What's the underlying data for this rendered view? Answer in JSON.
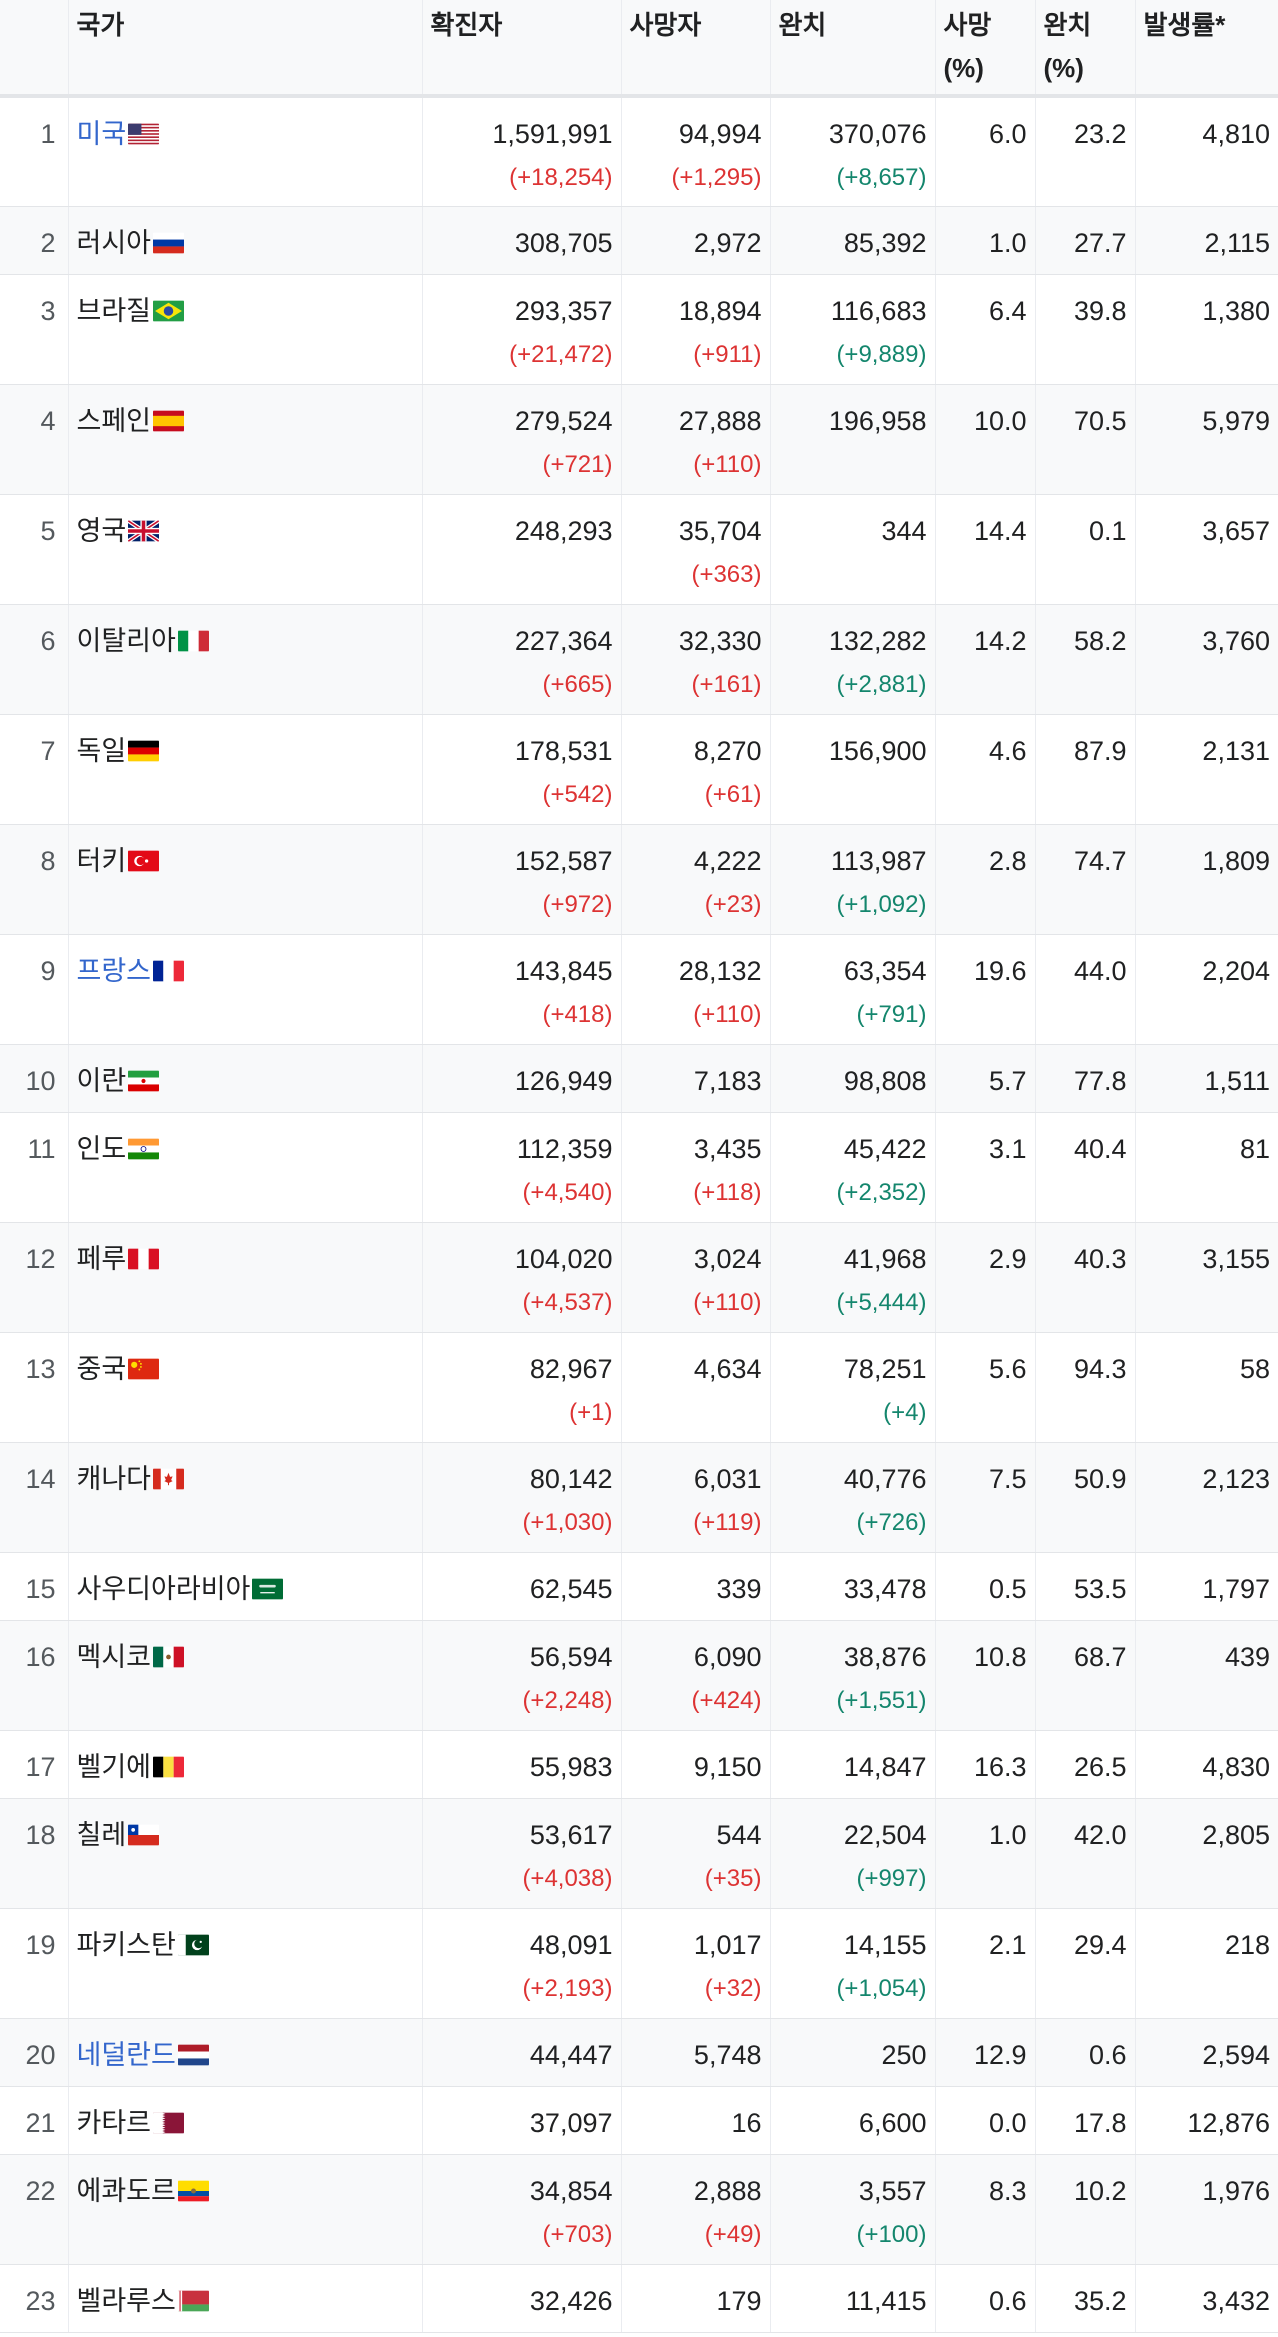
{
  "headers": {
    "rank": "",
    "country": "국가",
    "confirmed": "확진자",
    "deaths": "사망자",
    "recovered": "완치",
    "death_rate_line1": "사망",
    "death_rate_line2": "(%)",
    "recovery_rate_line1": "완치",
    "recovery_rate_line2": "(%)",
    "incidence": "발생률*"
  },
  "rows": [
    {
      "rank": "1",
      "country": "미국",
      "flag": "us-flag-icon",
      "link": true,
      "confirmed": "1,591,991",
      "confirmed_delta": "(+18,254)",
      "deaths": "94,994",
      "deaths_delta": "(+1,295)",
      "recovered": "370,076",
      "recovered_delta": "(+8,657)",
      "death_rate": "6.0",
      "recovery_rate": "23.2",
      "incidence": "4,810"
    },
    {
      "rank": "2",
      "country": "러시아",
      "flag": "russia-flag-icon",
      "link": false,
      "confirmed": "308,705",
      "confirmed_delta": "",
      "deaths": "2,972",
      "deaths_delta": "",
      "recovered": "85,392",
      "recovered_delta": "",
      "death_rate": "1.0",
      "recovery_rate": "27.7",
      "incidence": "2,115"
    },
    {
      "rank": "3",
      "country": "브라질",
      "flag": "brazil-flag-icon",
      "link": false,
      "confirmed": "293,357",
      "confirmed_delta": "(+21,472)",
      "deaths": "18,894",
      "deaths_delta": "(+911)",
      "recovered": "116,683",
      "recovered_delta": "(+9,889)",
      "death_rate": "6.4",
      "recovery_rate": "39.8",
      "incidence": "1,380"
    },
    {
      "rank": "4",
      "country": "스페인",
      "flag": "spain-flag-icon",
      "link": false,
      "confirmed": "279,524",
      "confirmed_delta": "(+721)",
      "deaths": "27,888",
      "deaths_delta": "(+110)",
      "recovered": "196,958",
      "recovered_delta": "",
      "death_rate": "10.0",
      "recovery_rate": "70.5",
      "incidence": "5,979"
    },
    {
      "rank": "5",
      "country": "영국",
      "flag": "uk-flag-icon",
      "link": false,
      "confirmed": "248,293",
      "confirmed_delta": "",
      "deaths": "35,704",
      "deaths_delta": "(+363)",
      "recovered": "344",
      "recovered_delta": "",
      "death_rate": "14.4",
      "recovery_rate": "0.1",
      "incidence": "3,657"
    },
    {
      "rank": "6",
      "country": "이탈리아",
      "flag": "italy-flag-icon",
      "link": false,
      "confirmed": "227,364",
      "confirmed_delta": "(+665)",
      "deaths": "32,330",
      "deaths_delta": "(+161)",
      "recovered": "132,282",
      "recovered_delta": "(+2,881)",
      "death_rate": "14.2",
      "recovery_rate": "58.2",
      "incidence": "3,760"
    },
    {
      "rank": "7",
      "country": "독일",
      "flag": "germany-flag-icon",
      "link": false,
      "confirmed": "178,531",
      "confirmed_delta": "(+542)",
      "deaths": "8,270",
      "deaths_delta": "(+61)",
      "recovered": "156,900",
      "recovered_delta": "",
      "death_rate": "4.6",
      "recovery_rate": "87.9",
      "incidence": "2,131"
    },
    {
      "rank": "8",
      "country": "터키",
      "flag": "turkey-flag-icon",
      "link": false,
      "confirmed": "152,587",
      "confirmed_delta": "(+972)",
      "deaths": "4,222",
      "deaths_delta": "(+23)",
      "recovered": "113,987",
      "recovered_delta": "(+1,092)",
      "death_rate": "2.8",
      "recovery_rate": "74.7",
      "incidence": "1,809"
    },
    {
      "rank": "9",
      "country": "프랑스",
      "flag": "france-flag-icon",
      "link": true,
      "confirmed": "143,845",
      "confirmed_delta": "(+418)",
      "deaths": "28,132",
      "deaths_delta": "(+110)",
      "recovered": "63,354",
      "recovered_delta": "(+791)",
      "death_rate": "19.6",
      "recovery_rate": "44.0",
      "incidence": "2,204"
    },
    {
      "rank": "10",
      "country": "이란",
      "flag": "iran-flag-icon",
      "link": false,
      "confirmed": "126,949",
      "confirmed_delta": "",
      "deaths": "7,183",
      "deaths_delta": "",
      "recovered": "98,808",
      "recovered_delta": "",
      "death_rate": "5.7",
      "recovery_rate": "77.8",
      "incidence": "1,511"
    },
    {
      "rank": "11",
      "country": "인도",
      "flag": "india-flag-icon",
      "link": false,
      "confirmed": "112,359",
      "confirmed_delta": "(+4,540)",
      "deaths": "3,435",
      "deaths_delta": "(+118)",
      "recovered": "45,422",
      "recovered_delta": "(+2,352)",
      "death_rate": "3.1",
      "recovery_rate": "40.4",
      "incidence": "81"
    },
    {
      "rank": "12",
      "country": "페루",
      "flag": "peru-flag-icon",
      "link": false,
      "confirmed": "104,020",
      "confirmed_delta": "(+4,537)",
      "deaths": "3,024",
      "deaths_delta": "(+110)",
      "recovered": "41,968",
      "recovered_delta": "(+5,444)",
      "death_rate": "2.9",
      "recovery_rate": "40.3",
      "incidence": "3,155"
    },
    {
      "rank": "13",
      "country": "중국",
      "flag": "china-flag-icon",
      "link": false,
      "confirmed": "82,967",
      "confirmed_delta": "(+1)",
      "deaths": "4,634",
      "deaths_delta": "",
      "recovered": "78,251",
      "recovered_delta": "(+4)",
      "death_rate": "5.6",
      "recovery_rate": "94.3",
      "incidence": "58"
    },
    {
      "rank": "14",
      "country": "캐나다",
      "flag": "canada-flag-icon",
      "link": false,
      "confirmed": "80,142",
      "confirmed_delta": "(+1,030)",
      "deaths": "6,031",
      "deaths_delta": "(+119)",
      "recovered": "40,776",
      "recovered_delta": "(+726)",
      "death_rate": "7.5",
      "recovery_rate": "50.9",
      "incidence": "2,123"
    },
    {
      "rank": "15",
      "country": "사우디아라비아",
      "flag": "saudi-arabia-flag-icon",
      "link": false,
      "confirmed": "62,545",
      "confirmed_delta": "",
      "deaths": "339",
      "deaths_delta": "",
      "recovered": "33,478",
      "recovered_delta": "",
      "death_rate": "0.5",
      "recovery_rate": "53.5",
      "incidence": "1,797"
    },
    {
      "rank": "16",
      "country": "멕시코",
      "flag": "mexico-flag-icon",
      "link": false,
      "confirmed": "56,594",
      "confirmed_delta": "(+2,248)",
      "deaths": "6,090",
      "deaths_delta": "(+424)",
      "recovered": "38,876",
      "recovered_delta": "(+1,551)",
      "death_rate": "10.8",
      "recovery_rate": "68.7",
      "incidence": "439"
    },
    {
      "rank": "17",
      "country": "벨기에",
      "flag": "belgium-flag-icon",
      "link": false,
      "confirmed": "55,983",
      "confirmed_delta": "",
      "deaths": "9,150",
      "deaths_delta": "",
      "recovered": "14,847",
      "recovered_delta": "",
      "death_rate": "16.3",
      "recovery_rate": "26.5",
      "incidence": "4,830"
    },
    {
      "rank": "18",
      "country": "칠레",
      "flag": "chile-flag-icon",
      "link": false,
      "confirmed": "53,617",
      "confirmed_delta": "(+4,038)",
      "deaths": "544",
      "deaths_delta": "(+35)",
      "recovered": "22,504",
      "recovered_delta": "(+997)",
      "death_rate": "1.0",
      "recovery_rate": "42.0",
      "incidence": "2,805"
    },
    {
      "rank": "19",
      "country": "파키스탄",
      "flag": "pakistan-flag-icon",
      "link": false,
      "confirmed": "48,091",
      "confirmed_delta": "(+2,193)",
      "deaths": "1,017",
      "deaths_delta": "(+32)",
      "recovered": "14,155",
      "recovered_delta": "(+1,054)",
      "death_rate": "2.1",
      "recovery_rate": "29.4",
      "incidence": "218"
    },
    {
      "rank": "20",
      "country": "네덜란드",
      "flag": "netherlands-flag-icon",
      "link": true,
      "confirmed": "44,447",
      "confirmed_delta": "",
      "deaths": "5,748",
      "deaths_delta": "",
      "recovered": "250",
      "recovered_delta": "",
      "death_rate": "12.9",
      "recovery_rate": "0.6",
      "incidence": "2,594"
    },
    {
      "rank": "21",
      "country": "카타르",
      "flag": "qatar-flag-icon",
      "link": false,
      "confirmed": "37,097",
      "confirmed_delta": "",
      "deaths": "16",
      "deaths_delta": "",
      "recovered": "6,600",
      "recovered_delta": "",
      "death_rate": "0.0",
      "recovery_rate": "17.8",
      "incidence": "12,876"
    },
    {
      "rank": "22",
      "country": "에콰도르",
      "flag": "ecuador-flag-icon",
      "link": false,
      "confirmed": "34,854",
      "confirmed_delta": "(+703)",
      "deaths": "2,888",
      "deaths_delta": "(+49)",
      "recovered": "3,557",
      "recovered_delta": "(+100)",
      "death_rate": "8.3",
      "recovery_rate": "10.2",
      "incidence": "1,976"
    },
    {
      "rank": "23",
      "country": "벨라루스",
      "flag": "belarus-flag-icon",
      "link": false,
      "confirmed": "32,426",
      "confirmed_delta": "",
      "deaths": "179",
      "deaths_delta": "",
      "recovered": "11,415",
      "recovered_delta": "",
      "death_rate": "0.6",
      "recovery_rate": "35.2",
      "incidence": "3,432"
    }
  ]
}
